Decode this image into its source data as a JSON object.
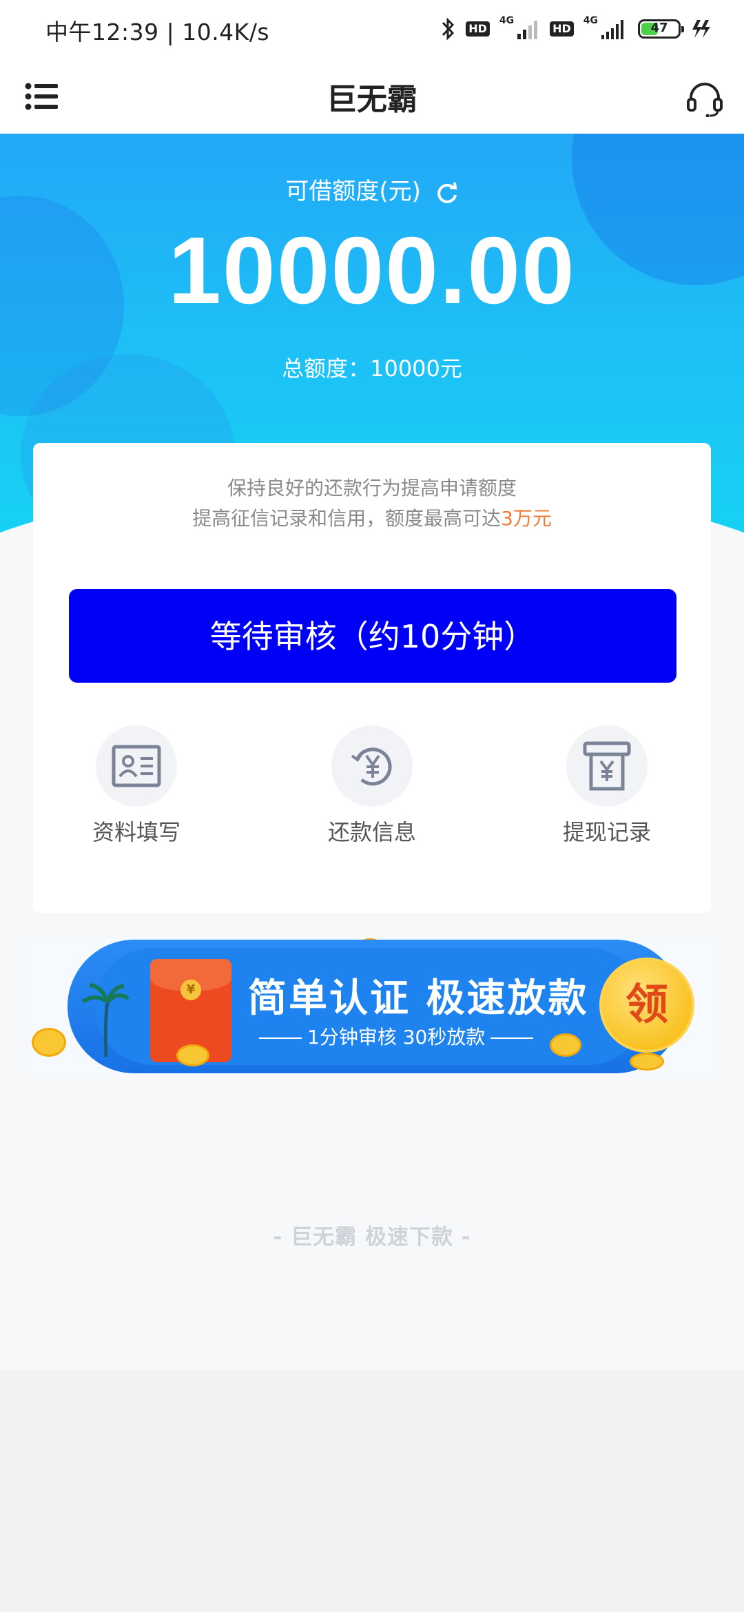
{
  "status_bar": {
    "time_speed": "中午12:39 | 10.4K/s",
    "hd1": "HD",
    "net1": "4G",
    "hd2": "HD",
    "net2": "4G",
    "battery": "47",
    "battery_level": 0.47
  },
  "header": {
    "title": "巨无霸",
    "menu_icon": "list-icon",
    "support_icon": "headset-icon"
  },
  "hero": {
    "label": "可借额度(元)",
    "amount": "10000.00",
    "total": "总额度：10000元"
  },
  "card": {
    "tip_line1": "保持良好的还款行为提高申请额度",
    "tip_line2_prefix": "提高征信记录和信用，额度最高可达",
    "tip_line2_highlight": "3万元",
    "main_button": "等待审核（约10分钟）",
    "quick_actions": [
      {
        "label": "资料填写",
        "icon": "id-card-icon"
      },
      {
        "label": "还款信息",
        "icon": "yuan-cycle-icon"
      },
      {
        "label": "提现记录",
        "icon": "atm-yuan-icon"
      }
    ]
  },
  "banner": {
    "title": "简单认证  极速放款",
    "subtitle": "1分钟审核 30秒放款",
    "badge": "领",
    "packet_symbol": "¥"
  },
  "footer": {
    "slogan": "- 巨无霸   极速下款 -"
  },
  "colors": {
    "primary_button": "#0000f7",
    "hero_gradient_top": "#22a8f7",
    "hero_gradient_bottom": "#16d2f4",
    "highlight": "#ef7b37"
  }
}
